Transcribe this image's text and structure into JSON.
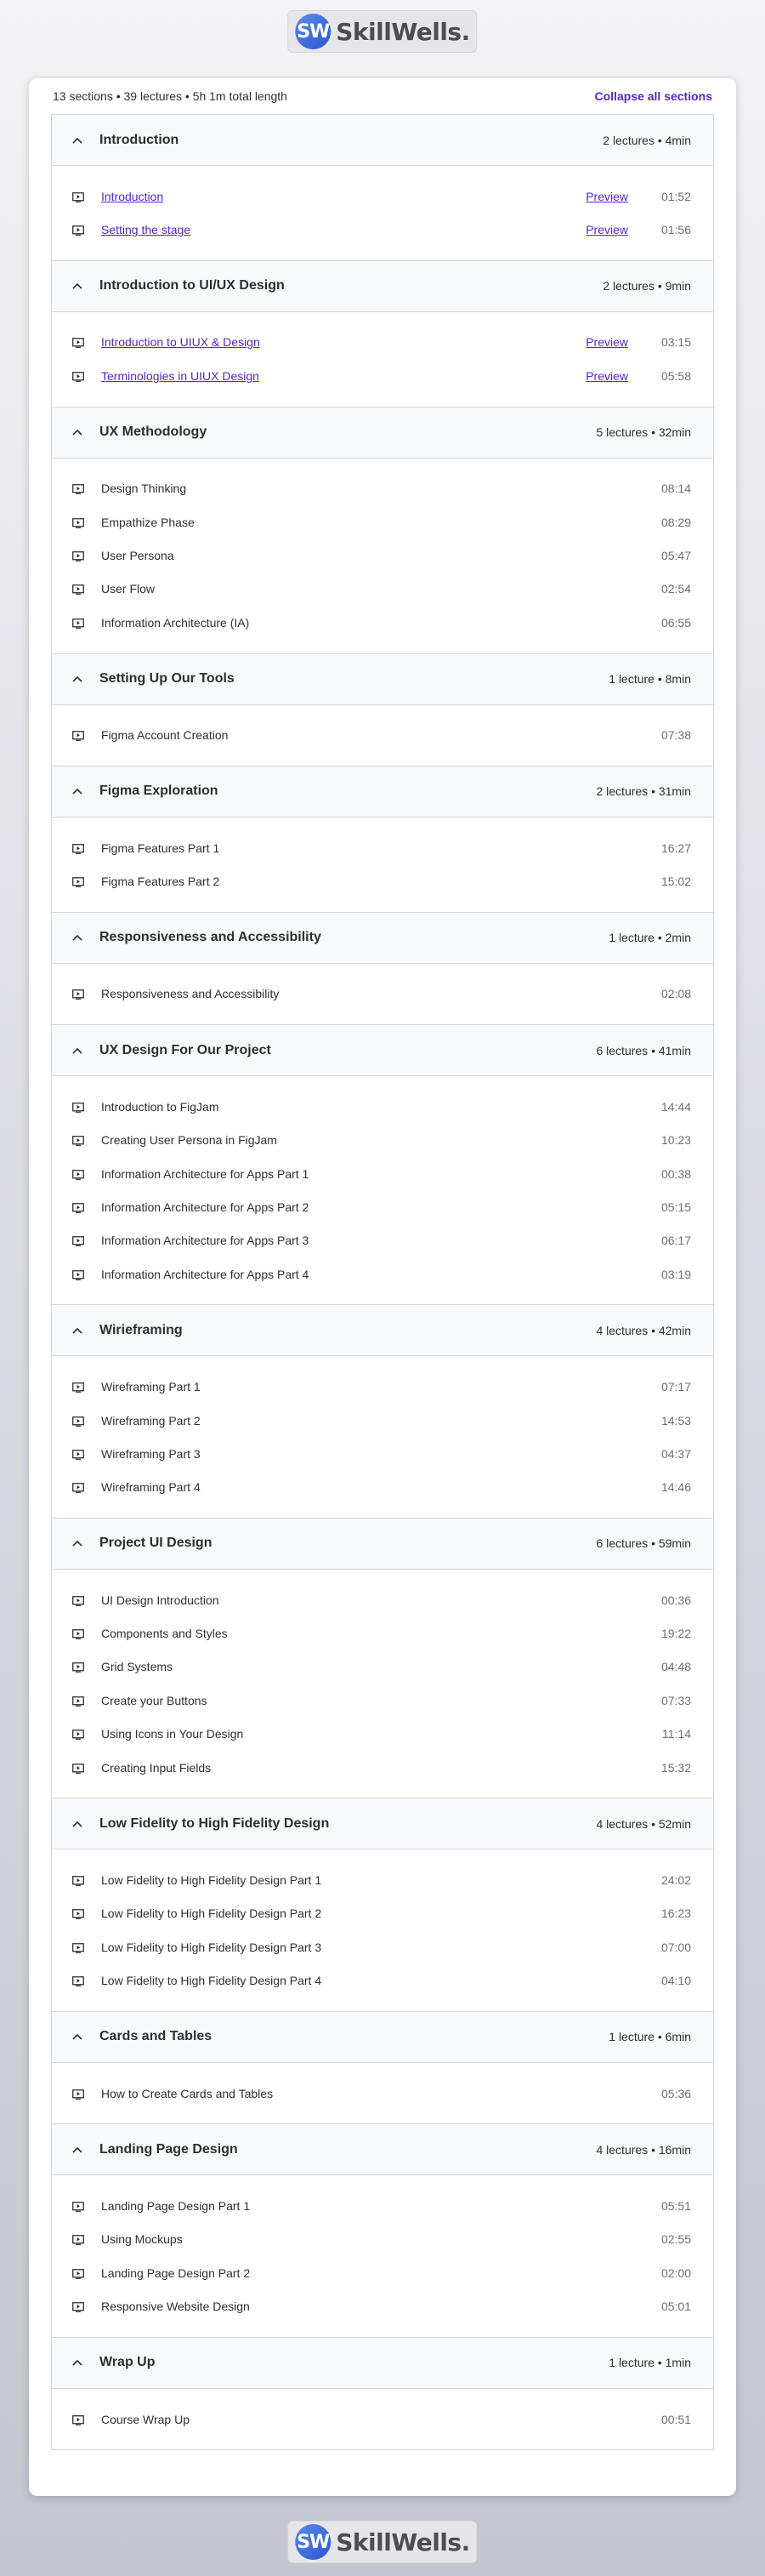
{
  "brand": {
    "badge": "SW",
    "name": "SkillWells."
  },
  "summary": {
    "text": "13 sections • 39 lectures • 5h 1m total length",
    "collapse_label": "Collapse all sections"
  },
  "colors": {
    "accent": "#5624d0",
    "header_bg": "#f7f9fa",
    "border": "#d1d7dc"
  },
  "sections": [
    {
      "title": "Introduction",
      "meta": "2 lectures • 4min",
      "lectures": [
        {
          "title": "Introduction",
          "duration": "01:52",
          "preview": "Preview"
        },
        {
          "title": "Setting the stage",
          "duration": "01:56",
          "preview": "Preview"
        }
      ]
    },
    {
      "title": "Introduction to UI/UX Design",
      "meta": "2 lectures • 9min",
      "lectures": [
        {
          "title": "Introduction to UIUX & Design",
          "duration": "03:15",
          "preview": "Preview"
        },
        {
          "title": "Terminologies in UIUX Design",
          "duration": "05:58",
          "preview": "Preview"
        }
      ]
    },
    {
      "title": "UX Methodology",
      "meta": "5 lectures • 32min",
      "lectures": [
        {
          "title": "Design Thinking",
          "duration": "08:14"
        },
        {
          "title": "Empathize Phase",
          "duration": "08:29"
        },
        {
          "title": "User Persona",
          "duration": "05:47"
        },
        {
          "title": "User Flow",
          "duration": "02:54"
        },
        {
          "title": "Information Architecture (IA)",
          "duration": "06:55"
        }
      ]
    },
    {
      "title": "Setting Up Our Tools",
      "meta": "1 lecture • 8min",
      "lectures": [
        {
          "title": "Figma Account Creation",
          "duration": "07:38"
        }
      ]
    },
    {
      "title": "Figma Exploration",
      "meta": "2 lectures • 31min",
      "lectures": [
        {
          "title": "Figma Features Part 1",
          "duration": "16:27"
        },
        {
          "title": "Figma Features Part 2",
          "duration": "15:02"
        }
      ]
    },
    {
      "title": "Responsiveness and Accessibility",
      "meta": "1 lecture • 2min",
      "lectures": [
        {
          "title": "Responsiveness and Accessibility",
          "duration": "02:08"
        }
      ]
    },
    {
      "title": "UX Design For Our Project",
      "meta": "6 lectures • 41min",
      "lectures": [
        {
          "title": "Introduction to FigJam",
          "duration": "14:44"
        },
        {
          "title": "Creating User Persona in FigJam",
          "duration": "10:23"
        },
        {
          "title": "Information Architecture for Apps Part 1",
          "duration": "00:38"
        },
        {
          "title": "Information Architecture for Apps Part 2",
          "duration": "05:15"
        },
        {
          "title": "Information Architecture for Apps Part 3",
          "duration": "06:17"
        },
        {
          "title": "Information Architecture for Apps Part 4",
          "duration": "03:19"
        }
      ]
    },
    {
      "title": "Wirieframing",
      "meta": "4 lectures • 42min",
      "lectures": [
        {
          "title": "Wireframing Part 1",
          "duration": "07:17"
        },
        {
          "title": "Wireframing Part 2",
          "duration": "14:53"
        },
        {
          "title": "Wireframing Part 3",
          "duration": "04:37"
        },
        {
          "title": "Wireframing Part 4",
          "duration": "14:46"
        }
      ]
    },
    {
      "title": "Project UI Design",
      "meta": "6 lectures • 59min",
      "lectures": [
        {
          "title": "UI Design Introduction",
          "duration": "00:36"
        },
        {
          "title": "Components and Styles",
          "duration": "19:22"
        },
        {
          "title": "Grid Systems",
          "duration": "04:48"
        },
        {
          "title": "Create your Buttons",
          "duration": "07:33"
        },
        {
          "title": "Using Icons in Your Design",
          "duration": "11:14"
        },
        {
          "title": "Creating Input Fields",
          "duration": "15:32"
        }
      ]
    },
    {
      "title": "Low Fidelity to High Fidelity Design",
      "meta": "4 lectures • 52min",
      "lectures": [
        {
          "title": "Low Fidelity to High Fidelity Design Part 1",
          "duration": "24:02"
        },
        {
          "title": "Low Fidelity to High Fidelity Design Part 2",
          "duration": "16:23"
        },
        {
          "title": "Low Fidelity to High Fidelity Design Part 3",
          "duration": "07:00"
        },
        {
          "title": "Low Fidelity to High Fidelity Design Part 4",
          "duration": "04:10"
        }
      ]
    },
    {
      "title": "Cards and Tables",
      "meta": "1 lecture • 6min",
      "lectures": [
        {
          "title": "How to Create Cards and Tables",
          "duration": "05:36"
        }
      ]
    },
    {
      "title": "Landing Page Design",
      "meta": "4 lectures • 16min",
      "lectures": [
        {
          "title": "Landing Page Design Part 1",
          "duration": "05:51"
        },
        {
          "title": "Using Mockups",
          "duration": "02:55"
        },
        {
          "title": "Landing Page Design Part 2",
          "duration": "02:00"
        },
        {
          "title": "Responsive Website Design",
          "duration": "05:01"
        }
      ]
    },
    {
      "title": "Wrap Up",
      "meta": "1 lecture • 1min",
      "lectures": [
        {
          "title": "Course Wrap Up",
          "duration": "00:51"
        }
      ]
    }
  ]
}
